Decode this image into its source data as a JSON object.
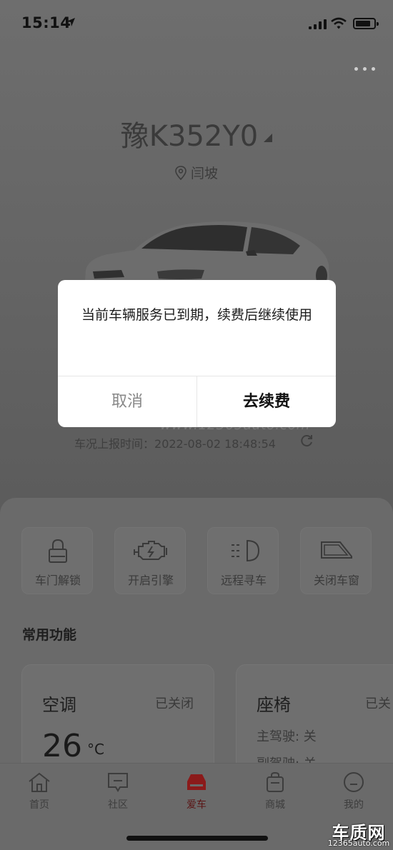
{
  "status_bar": {
    "time": "15:14"
  },
  "vehicle": {
    "plate": "豫K352Y0",
    "location": "闫坡",
    "report_label": "车况上报时间：",
    "report_time": "2022-08-02 18:48:54"
  },
  "quick_actions": [
    {
      "label": "车门解锁",
      "icon": "lock-icon"
    },
    {
      "label": "开启引擎",
      "icon": "engine-icon"
    },
    {
      "label": "远程寻车",
      "icon": "headlight-icon"
    },
    {
      "label": "关闭车窗",
      "icon": "window-icon"
    }
  ],
  "common_functions": {
    "title": "常用功能",
    "ac": {
      "title": "空调",
      "status": "已关闭",
      "temp": "26",
      "unit": "°C"
    },
    "seat": {
      "title": "座椅",
      "status": "已关",
      "driver": "主驾驶: 关",
      "passenger": "副驾驶: 关"
    }
  },
  "tabs": [
    {
      "label": "首页",
      "icon": "home-icon"
    },
    {
      "label": "社区",
      "icon": "community-icon"
    },
    {
      "label": "爱车",
      "icon": "car-icon",
      "active": true
    },
    {
      "label": "商城",
      "icon": "shop-bag-icon"
    },
    {
      "label": "我的",
      "icon": "profile-icon"
    }
  ],
  "modal": {
    "message": "当前车辆服务已到期，续费后继续使用",
    "cancel": "取消",
    "confirm": "去续费"
  },
  "watermarks": {
    "center": "www.12365auto.com",
    "brand": "车质网",
    "brand_url": "12365auto.com"
  },
  "colors": {
    "accent_red": "#8b1a1a",
    "dialog_bg": "#ffffff"
  }
}
